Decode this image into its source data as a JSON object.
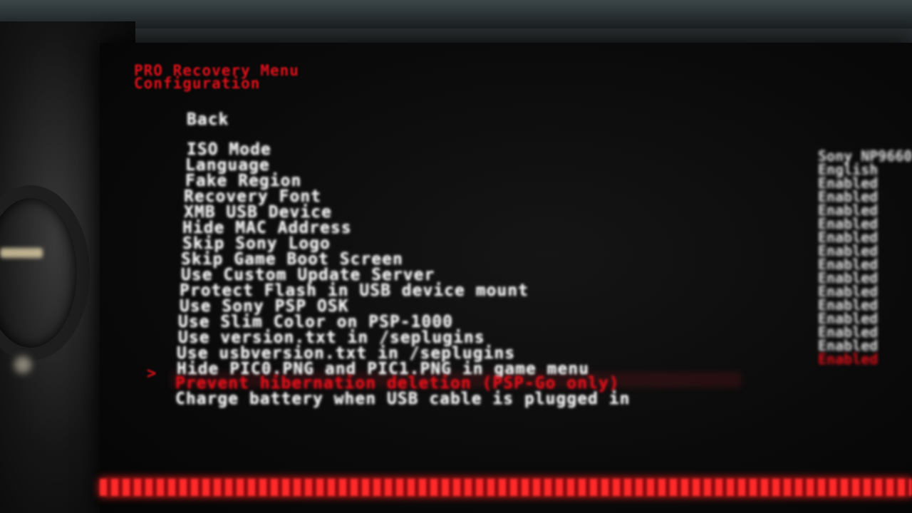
{
  "screen": {
    "title_lines": [
      "PRO Recovery Menu",
      "Configuration"
    ],
    "menu_items": [
      "Back",
      "ISO Mode",
      "Language",
      "Fake Region",
      "Recovery Font",
      "XMB USB Device",
      "Hide MAC Address",
      "Skip Sony Logo",
      "Skip Game Boot Screen",
      "Use Custom Update Server",
      "Protect Flash in USB device mount",
      "Use Sony PSP OSK",
      "Use Slim Color on PSP-1000",
      "Use version.txt in /seplugins",
      "Use usbversion.txt in /seplugins",
      "Hide PIC0.PNG and PIC1.PNG in game menu",
      "Prevent hibernation deletion (PSP-Go only)",
      "Charge battery when USB cable is plugged in"
    ],
    "selected_index": 16,
    "cursor_glyph": ">",
    "side_values": [
      "Sony NP9660",
      "English",
      "Enabled",
      "Enabled",
      "Enabled",
      "Enabled",
      "Enabled",
      "Enabled",
      "Enabled",
      "Enabled",
      "Enabled",
      "Enabled",
      "Enabled",
      "Enabled",
      "Enabled",
      "Enabled"
    ],
    "colors": {
      "accent": "#e0101a",
      "text": "#f0f0f0",
      "background": "#0a0a0a"
    }
  }
}
